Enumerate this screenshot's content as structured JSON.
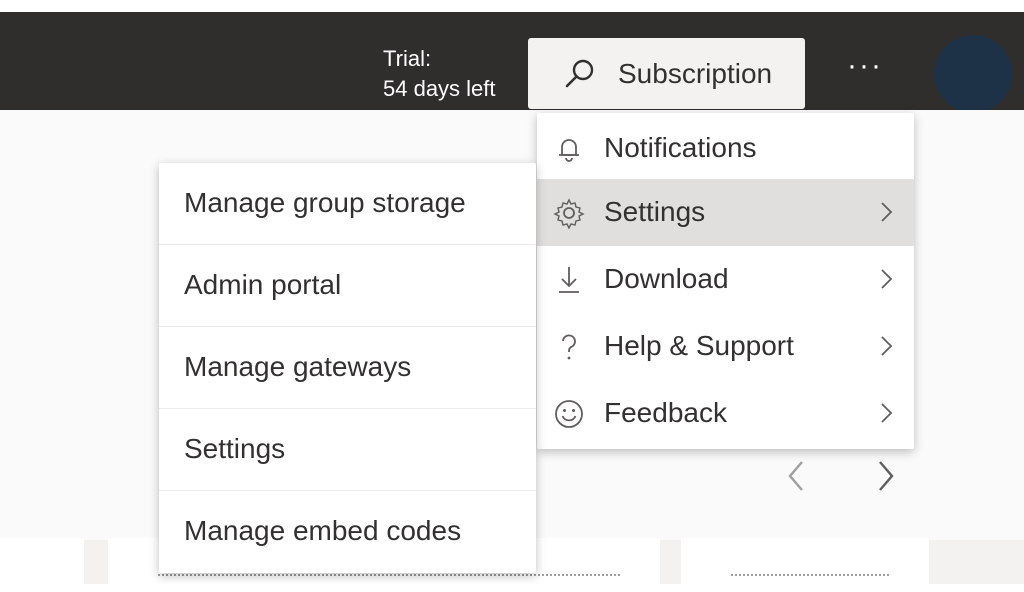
{
  "header": {
    "trial_line1": "Trial:",
    "trial_line2": "54 days left",
    "subscription_label": "Subscription",
    "more_label": "···",
    "bg_color": "#2f2e2d",
    "avatar_color": "#1d3147"
  },
  "menu": {
    "items": [
      {
        "label": "Notifications",
        "icon": "bell-icon",
        "has_submenu": false
      },
      {
        "label": "Settings",
        "icon": "gear-icon",
        "has_submenu": true,
        "active": true
      },
      {
        "label": "Download",
        "icon": "download-icon",
        "has_submenu": true
      },
      {
        "label": "Help & Support",
        "icon": "question-icon",
        "has_submenu": true
      },
      {
        "label": "Feedback",
        "icon": "smiley-icon",
        "has_submenu": true
      }
    ]
  },
  "settings_submenu": {
    "items": [
      {
        "label": "Manage group storage"
      },
      {
        "label": "Admin portal"
      },
      {
        "label": "Manage gateways"
      },
      {
        "label": "Settings"
      },
      {
        "label": "Manage embed codes"
      }
    ]
  },
  "carousel": {
    "prev_label": "‹",
    "next_label": "›"
  }
}
